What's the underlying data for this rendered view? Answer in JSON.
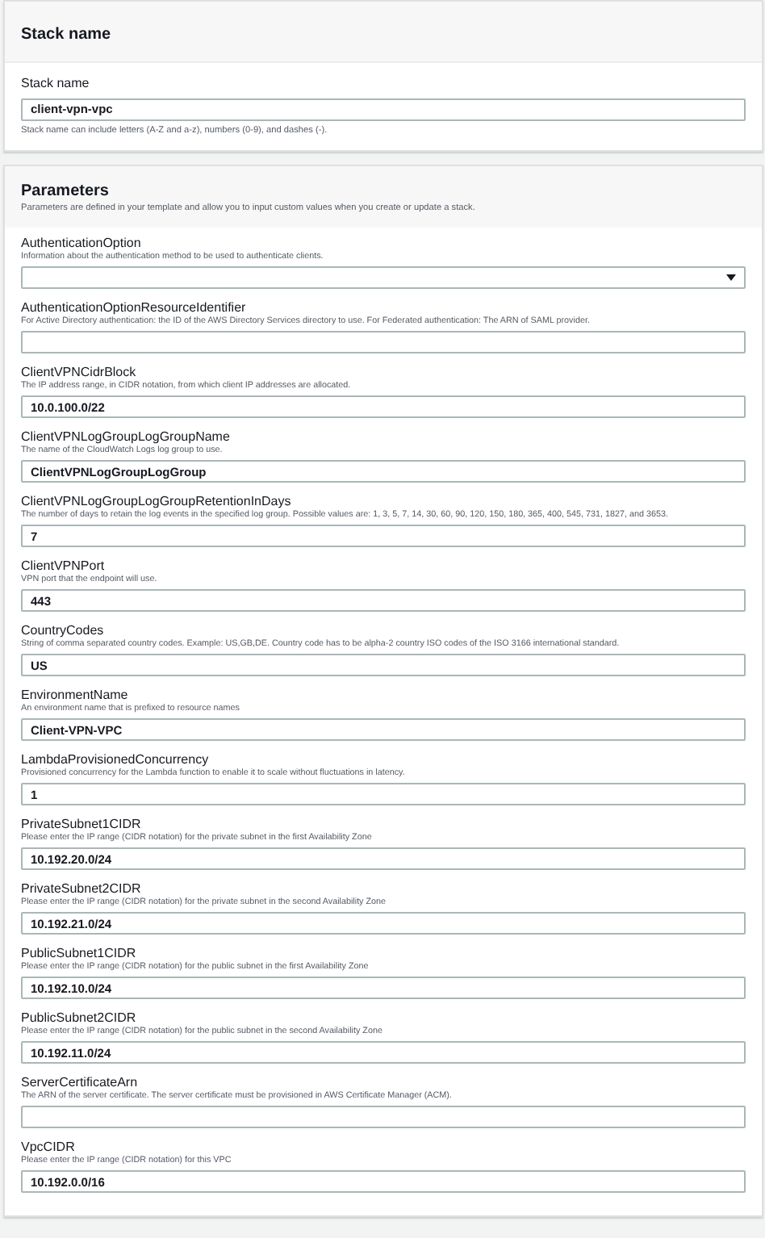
{
  "stack_section": {
    "title": "Stack name",
    "label": "Stack name",
    "value": "client-vpn-vpc",
    "hint": "Stack name can include letters (A-Z and a-z), numbers (0-9), and dashes (-)."
  },
  "parameters_section": {
    "title": "Parameters",
    "description": "Parameters are defined in your template and allow you to input custom values when you create or update a stack.",
    "parameters": [
      {
        "kind": "select",
        "label": "AuthenticationOption",
        "description": "Information about the authentication method to be used to authenticate clients."
      },
      {
        "kind": "text",
        "label": "AuthenticationOptionResourceIdentifier",
        "description": "For Active Directory authentication: the ID of the AWS Directory Services directory to use. For Federated authentication: The ARN of SAML provider."
      },
      {
        "kind": "text",
        "label": "ClientVPNCidrBlock",
        "description": "The IP address range, in CIDR notation, from which client IP addresses are allocated.",
        "value": "10.0.100.0/22"
      },
      {
        "kind": "text",
        "label": "ClientVPNLogGroupLogGroupName",
        "description": "The name of the CloudWatch Logs log group to use.",
        "value": "ClientVPNLogGroupLogGroup"
      },
      {
        "kind": "text",
        "label": "ClientVPNLogGroupLogGroupRetentionInDays",
        "description": "The number of days to retain the log events in the specified log group. Possible values are: 1, 3, 5, 7, 14, 30, 60, 90, 120, 150, 180, 365, 400, 545, 731, 1827, and 3653.",
        "value": "7"
      },
      {
        "kind": "text",
        "label": "ClientVPNPort",
        "description": "VPN port that the endpoint will use.",
        "value": "443"
      },
      {
        "kind": "text",
        "label": "CountryCodes",
        "description": "String of comma separated country codes. Example: US,GB,DE. Country code has to be alpha-2 country ISO codes of the ISO 3166 international standard.",
        "value": "US"
      },
      {
        "kind": "text",
        "label": "EnvironmentName",
        "description": "An environment name that is prefixed to resource names",
        "value": "Client-VPN-VPC"
      },
      {
        "kind": "text",
        "label": "LambdaProvisionedConcurrency",
        "description": "Provisioned concurrency for the Lambda function to enable it to scale without fluctuations in latency.",
        "value": "1"
      },
      {
        "kind": "text",
        "label": "PrivateSubnet1CIDR",
        "description": "Please enter the IP range (CIDR notation) for the private subnet in the first Availability Zone",
        "value": "10.192.20.0/24"
      },
      {
        "kind": "text",
        "label": "PrivateSubnet2CIDR",
        "description": "Please enter the IP range (CIDR notation) for the private subnet in the second Availability Zone",
        "value": "10.192.21.0/24"
      },
      {
        "kind": "text",
        "label": "PublicSubnet1CIDR",
        "description": "Please enter the IP range (CIDR notation) for the public subnet in the first Availability Zone",
        "value": "10.192.10.0/24"
      },
      {
        "kind": "text",
        "label": "PublicSubnet2CIDR",
        "description": "Please enter the IP range (CIDR notation) for the public subnet in the second Availability Zone",
        "value": "10.192.11.0/24"
      },
      {
        "kind": "text",
        "label": "ServerCertificateArn",
        "description": "The ARN of the server certificate. The server certificate must be provisioned in AWS Certificate Manager (ACM)."
      },
      {
        "kind": "text",
        "label": "VpcCIDR",
        "description": "Please enter the IP range (CIDR notation) for this VPC",
        "value": "10.192.0.0/16"
      }
    ]
  }
}
